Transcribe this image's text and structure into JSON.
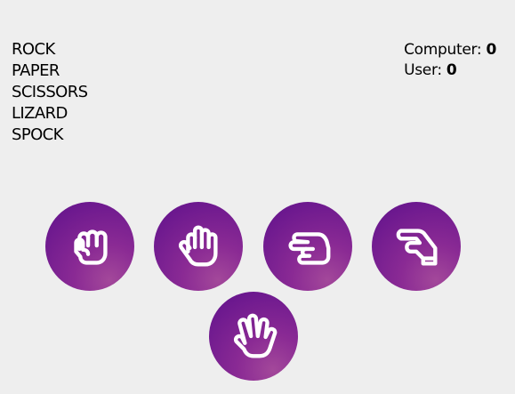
{
  "title": {
    "lines": [
      "ROCK",
      "PAPER",
      "SCISSORS",
      "LIZARD",
      "SPOCK"
    ]
  },
  "scoreboard": {
    "computer_label": "Computer:",
    "computer_score": "0",
    "user_label": "User:",
    "user_score": "0"
  },
  "choices": [
    {
      "name": "rock",
      "icon": "hand-rock-icon"
    },
    {
      "name": "paper",
      "icon": "hand-paper-icon"
    },
    {
      "name": "scissors",
      "icon": "hand-scissors-icon"
    },
    {
      "name": "lizard",
      "icon": "hand-lizard-icon"
    },
    {
      "name": "spock",
      "icon": "hand-spock-icon"
    }
  ],
  "colors": {
    "background": "#eeeeee",
    "button_dark": "#5e108c",
    "button_light": "#a3489a",
    "icon": "#ffffff"
  }
}
